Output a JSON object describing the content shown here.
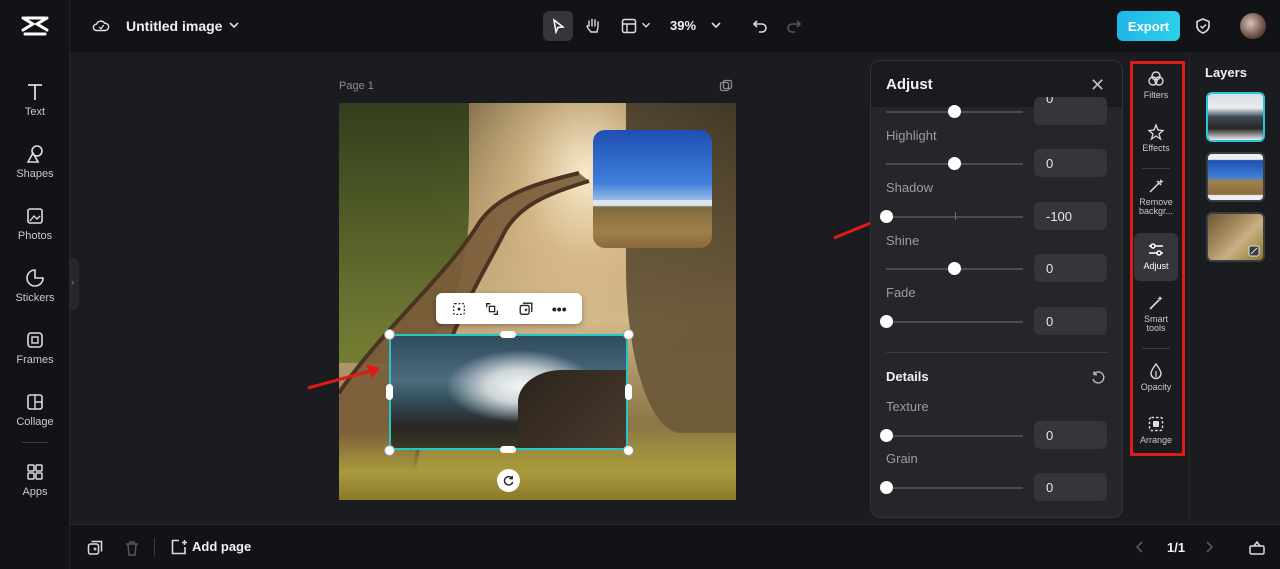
{
  "app": {
    "doc_title": "Untitled image",
    "zoom": "39%",
    "export_label": "Export"
  },
  "leftbar": {
    "items": [
      {
        "label": "Text",
        "icon": "text-icon"
      },
      {
        "label": "Shapes",
        "icon": "shapes-icon"
      },
      {
        "label": "Photos",
        "icon": "photos-icon"
      },
      {
        "label": "Stickers",
        "icon": "stickers-icon"
      },
      {
        "label": "Frames",
        "icon": "frames-icon"
      },
      {
        "label": "Collage",
        "icon": "collage-icon"
      },
      {
        "label": "Apps",
        "icon": "apps-icon"
      }
    ]
  },
  "canvas": {
    "page_label": "Page 1"
  },
  "adjust": {
    "title": "Adjust",
    "sliders": [
      {
        "label": "",
        "value": "0",
        "position": 0.5
      },
      {
        "label": "Highlight",
        "value": "0",
        "position": 0.5
      },
      {
        "label": "Shadow",
        "value": "-100",
        "position": 0.0
      },
      {
        "label": "Shine",
        "value": "0",
        "position": 0.5
      },
      {
        "label": "Fade",
        "value": "0",
        "position": 0.0
      }
    ],
    "details_title": "Details",
    "details": [
      {
        "label": "Texture",
        "value": "0",
        "position": 0.0
      },
      {
        "label": "Grain",
        "value": "0",
        "position": 0.0
      }
    ]
  },
  "tools": {
    "items": [
      {
        "label": "Filters",
        "icon": "filters-icon"
      },
      {
        "label": "Effects",
        "icon": "effects-icon"
      },
      {
        "label": "Remove backgr...",
        "icon": "remove-background-icon"
      },
      {
        "label": "Adjust",
        "icon": "adjust-icon"
      },
      {
        "label": "Smart tools",
        "icon": "smart-tools-icon"
      },
      {
        "label": "Opacity",
        "icon": "opacity-icon"
      },
      {
        "label": "Arrange",
        "icon": "arrange-icon"
      }
    ]
  },
  "layers": {
    "title": "Layers"
  },
  "bottombar": {
    "add_page": "Add page",
    "page_count": "1/1"
  },
  "colors": {
    "accent": "#24c6c6",
    "export": "#1fb6e8",
    "highlight_box": "#e01919"
  }
}
